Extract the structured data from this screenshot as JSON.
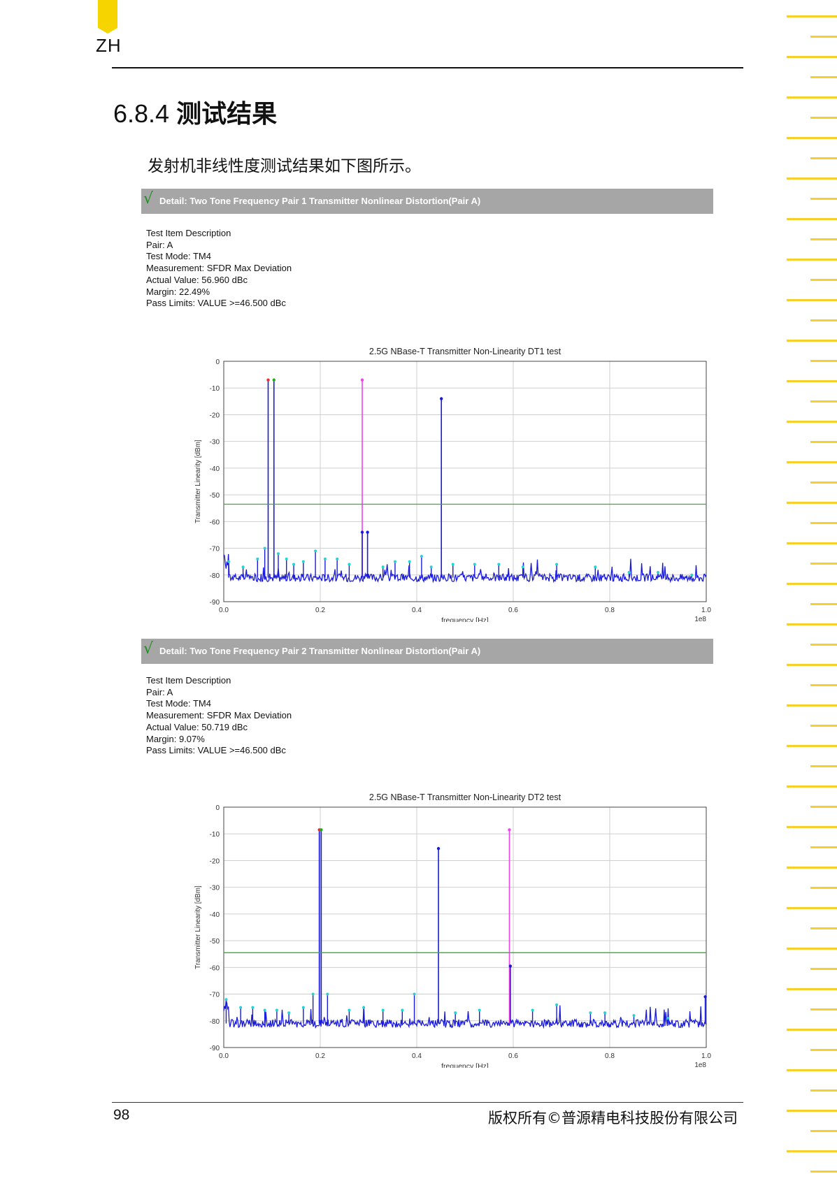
{
  "header": {
    "lang": "ZH"
  },
  "section": {
    "number": "6.8.4",
    "title": "测试结果"
  },
  "intro": "发射机非线性度测试结果如下图所示。",
  "details": [
    {
      "check": "√",
      "title": "Detail: Two Tone Frequency Pair 1 Transmitter Nonlinear Distortion(Pair A)",
      "lines": [
        "Test Item Description",
        "Pair: A",
        "Test Mode: TM4",
        "Measurement: SFDR Max Deviation",
        "Actual Value: 56.960 dBc",
        "Margin: 22.49%",
        "Pass Limits: VALUE >=46.500 dBc"
      ]
    },
    {
      "check": "√",
      "title": "Detail: Two Tone Frequency Pair 2 Transmitter Nonlinear Distortion(Pair A)",
      "lines": [
        "Test Item Description",
        "Pair: A",
        "Test Mode: TM4",
        "Measurement: SFDR Max Deviation",
        "Actual Value: 50.719 dBc",
        "Margin: 9.07%",
        "Pass Limits: VALUE >=46.500 dBc"
      ]
    }
  ],
  "chart_data": [
    {
      "type": "line",
      "title": "2.5G NBase-T Transmitter Non-Linearity DT1 test",
      "xlabel": "frequency [Hz]",
      "ylabel": "Transmitter Linearity [dBm]",
      "x_scale_note": "1e8",
      "xlim": [
        0.0,
        1.0
      ],
      "ylim": [
        -90,
        0
      ],
      "x_ticks": [
        "0.0",
        "0.2",
        "0.4",
        "0.6",
        "0.8",
        "1.0"
      ],
      "y_ticks": [
        "0",
        "-10",
        "-20",
        "-30",
        "-40",
        "-50",
        "-60",
        "-70",
        "-80",
        "-90"
      ],
      "grid": true,
      "noise_floor": -81,
      "limit_line": {
        "y": -53.5,
        "color": "#22bb22"
      },
      "series_color": "#1a1adc",
      "marker_color": "#2ad1d1",
      "peaks": [
        {
          "x": 0.092,
          "y": -7,
          "color": "#1a1adc",
          "marker": "#e03030"
        },
        {
          "x": 0.104,
          "y": -7,
          "color": "#1a1adc",
          "marker": "#22aa22"
        },
        {
          "x": 0.287,
          "y": -7,
          "color": "#ee44ee"
        },
        {
          "x": 0.451,
          "y": -14,
          "color": "#1a1adc"
        },
        {
          "x": 0.287,
          "y": -64,
          "color": "#1a1adc"
        },
        {
          "x": 0.298,
          "y": -64,
          "color": "#1a1adc"
        }
      ],
      "spurs": [
        {
          "x": 0.01,
          "y": -75
        },
        {
          "x": 0.04,
          "y": -77
        },
        {
          "x": 0.07,
          "y": -74
        },
        {
          "x": 0.085,
          "y": -70
        },
        {
          "x": 0.113,
          "y": -72
        },
        {
          "x": 0.13,
          "y": -74
        },
        {
          "x": 0.145,
          "y": -76
        },
        {
          "x": 0.165,
          "y": -75
        },
        {
          "x": 0.19,
          "y": -71
        },
        {
          "x": 0.21,
          "y": -74
        },
        {
          "x": 0.235,
          "y": -74
        },
        {
          "x": 0.26,
          "y": -76
        },
        {
          "x": 0.33,
          "y": -77
        },
        {
          "x": 0.355,
          "y": -75
        },
        {
          "x": 0.385,
          "y": -75
        },
        {
          "x": 0.41,
          "y": -73
        },
        {
          "x": 0.43,
          "y": -77
        },
        {
          "x": 0.475,
          "y": -76
        },
        {
          "x": 0.52,
          "y": -76
        },
        {
          "x": 0.57,
          "y": -76
        },
        {
          "x": 0.62,
          "y": -77
        },
        {
          "x": 0.69,
          "y": -76
        },
        {
          "x": 0.77,
          "y": -77
        },
        {
          "x": 0.84,
          "y": -79
        },
        {
          "x": 0.9,
          "y": -79
        },
        {
          "x": 0.97,
          "y": -80
        }
      ]
    },
    {
      "type": "line",
      "title": "2.5G NBase-T Transmitter Non-Linearity DT2 test",
      "xlabel": "frequency [Hz]",
      "ylabel": "Transmitter Linearity [dBm]",
      "x_scale_note": "1e8",
      "xlim": [
        0.0,
        1.0
      ],
      "ylim": [
        -90,
        0
      ],
      "x_ticks": [
        "0.0",
        "0.2",
        "0.4",
        "0.6",
        "0.8",
        "1.0"
      ],
      "y_ticks": [
        "0",
        "-10",
        "-20",
        "-30",
        "-40",
        "-50",
        "-60",
        "-70",
        "-80",
        "-90"
      ],
      "grid": true,
      "noise_floor": -81,
      "limit_line": {
        "y": -54.5,
        "color": "#22bb22"
      },
      "series_color": "#1a1adc",
      "marker_color": "#2ad1d1",
      "peaks": [
        {
          "x": 0.198,
          "y": -8.5,
          "color": "#1a1adc",
          "marker": "#e03030"
        },
        {
          "x": 0.202,
          "y": -8.5,
          "color": "#1a1adc",
          "marker": "#22aa22"
        },
        {
          "x": 0.445,
          "y": -15.5,
          "color": "#1a1adc"
        },
        {
          "x": 0.592,
          "y": -8.5,
          "color": "#ee44ee"
        },
        {
          "x": 0.594,
          "y": -59.5,
          "color": "#1a1adc"
        },
        {
          "x": 0.998,
          "y": -71,
          "color": "#1a1adc"
        }
      ],
      "spurs": [
        {
          "x": 0.005,
          "y": -72
        },
        {
          "x": 0.035,
          "y": -75
        },
        {
          "x": 0.06,
          "y": -75
        },
        {
          "x": 0.085,
          "y": -76
        },
        {
          "x": 0.11,
          "y": -76
        },
        {
          "x": 0.135,
          "y": -77
        },
        {
          "x": 0.165,
          "y": -75
        },
        {
          "x": 0.185,
          "y": -70
        },
        {
          "x": 0.215,
          "y": -70
        },
        {
          "x": 0.26,
          "y": -76
        },
        {
          "x": 0.29,
          "y": -75
        },
        {
          "x": 0.33,
          "y": -76
        },
        {
          "x": 0.37,
          "y": -76
        },
        {
          "x": 0.395,
          "y": -70
        },
        {
          "x": 0.48,
          "y": -77
        },
        {
          "x": 0.53,
          "y": -76
        },
        {
          "x": 0.64,
          "y": -76
        },
        {
          "x": 0.69,
          "y": -74
        },
        {
          "x": 0.76,
          "y": -77
        },
        {
          "x": 0.79,
          "y": -77
        },
        {
          "x": 0.85,
          "y": -78
        },
        {
          "x": 0.92,
          "y": -79
        }
      ]
    }
  ],
  "footer": {
    "page": "98",
    "copyright": "版权所有©普源精电科技股份有限公司"
  }
}
